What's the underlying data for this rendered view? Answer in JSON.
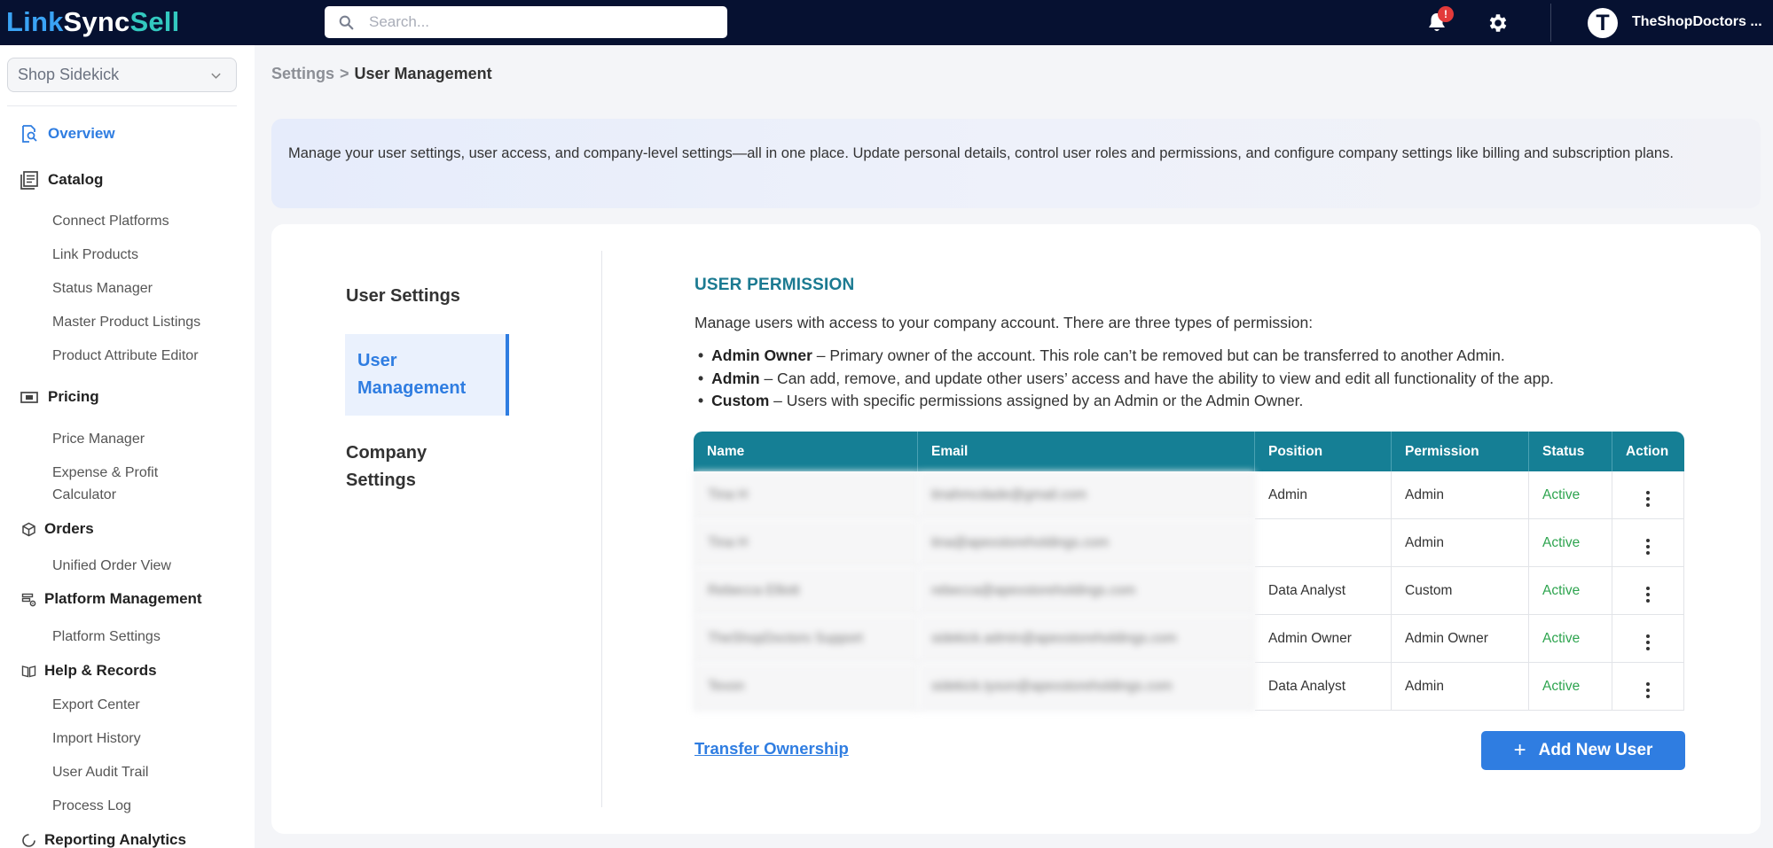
{
  "app": {
    "logo_part1": "Link",
    "logo_part2": "Sync",
    "logo_part3": "Sell",
    "search_placeholder": "Search...",
    "notification_badge": "!",
    "avatar_initial": "T",
    "username": "TheShopDoctors ..."
  },
  "sidebar": {
    "shop_selected": "Shop Sidekick",
    "overview": "Overview",
    "catalog": "Catalog",
    "catalog_items": [
      "Connect Platforms",
      "Link Products",
      "Status Manager",
      "Master Product Listings",
      "Product Attribute Editor"
    ],
    "pricing": "Pricing",
    "pricing_items": [
      "Price Manager",
      "Expense & Profit Calculator"
    ],
    "orders": "Orders",
    "orders_items": [
      "Unified Order View"
    ],
    "platform_management": "Platform Management",
    "platform_items": [
      "Platform Settings"
    ],
    "help_records": "Help & Records",
    "help_items": [
      "Export Center",
      "Import History",
      "User Audit Trail",
      "Process Log"
    ],
    "reporting": "Reporting Analytics"
  },
  "breadcrumb": {
    "parent": "Settings",
    "separator": ">",
    "current": "User Management"
  },
  "info_text": "Manage your user settings, user access, and company-level settings—all in one place. Update personal details, control user roles and permissions, and configure company settings like billing and subscription plans.",
  "tabs": {
    "user_settings": "User Settings",
    "user_management": "User Management",
    "company_settings": "Company Settings"
  },
  "permissions": {
    "title": "USER PERMISSION",
    "description": "Manage users with access to your company account. There are three types of permission:",
    "types": [
      {
        "name": "Admin Owner",
        "desc": " – Primary owner of the account. This role can’t be removed but can be transferred to another Admin."
      },
      {
        "name": "Admin",
        "desc": " – Can add, remove, and update other users’ access and have the ability to view and edit all functionality of the app."
      },
      {
        "name": "Custom",
        "desc": " – Users with specific permissions assigned by an Admin or the Admin Owner."
      }
    ]
  },
  "table": {
    "headers": {
      "name": "Name",
      "email": "Email",
      "position": "Position",
      "permission": "Permission",
      "status": "Status",
      "action": "Action"
    },
    "rows": [
      {
        "name": "Tina H",
        "email": "tinahmcdade@gmail.com",
        "position": "Admin",
        "permission": "Admin",
        "status": "Active"
      },
      {
        "name": "Tina H",
        "email": "tina@apexstoreholdings.com",
        "position": "",
        "permission": "Admin",
        "status": "Active"
      },
      {
        "name": "Rebecca Elliott",
        "email": "rebecca@apexstoreholdings.com",
        "position": "Data Analyst",
        "permission": "Custom",
        "status": "Active"
      },
      {
        "name": "TheShopDoctors Support",
        "email": "sidekick.admin@apexstoreholdings.com",
        "position": "Admin Owner",
        "permission": "Admin Owner",
        "status": "Active"
      },
      {
        "name": "Tevon",
        "email": "sidekick.tyson@apexstoreholdings.com",
        "position": "Data Analyst",
        "permission": "Admin",
        "status": "Active"
      }
    ]
  },
  "actions": {
    "transfer_ownership": "Transfer Ownership",
    "add_new_user": "Add New User",
    "add_icon": "+"
  },
  "colors": {
    "topbar": "#061131",
    "accent": "#2f7de1",
    "teal": "#157f95",
    "status_active": "#2ea44f"
  }
}
